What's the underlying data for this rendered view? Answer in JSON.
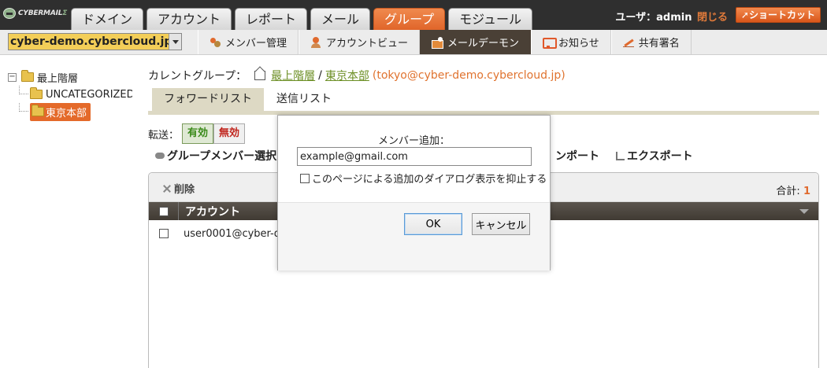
{
  "app": {
    "logo_text": "CYBERMAIL",
    "logo_sig": "Σ"
  },
  "main_tabs": [
    {
      "label": "ドメイン",
      "active": false
    },
    {
      "label": "アカウント",
      "active": false
    },
    {
      "label": "レポート",
      "active": false
    },
    {
      "label": "メール",
      "active": false
    },
    {
      "label": "グループ",
      "active": true
    },
    {
      "label": "モジュール",
      "active": false
    }
  ],
  "user": {
    "prefix": "ユーザ：admin",
    "close_label": "閉じる",
    "shortcut_label": "ショートカット"
  },
  "domain_select": {
    "value": "cyber-demo.cybercloud.jp"
  },
  "sub_tabs": [
    {
      "label": "メンバー管理",
      "icon": "members-icon",
      "active": false
    },
    {
      "label": "アカウントビュー",
      "icon": "account-view-icon",
      "active": false
    },
    {
      "label": "メールデーモン",
      "icon": "mail-daemon-icon",
      "active": true
    },
    {
      "label": "お知らせ",
      "icon": "notice-icon",
      "active": false
    },
    {
      "label": "共有署名",
      "icon": "signature-icon",
      "active": false
    }
  ],
  "tree": {
    "root": {
      "label": "最上階層",
      "toggle": "−"
    },
    "children": [
      {
        "label": "UNCATEGORIZED",
        "selected": false
      },
      {
        "label": "東京本部",
        "selected": true
      }
    ]
  },
  "breadcrumb": {
    "label": "カレントグループ：",
    "root": "最上階層",
    "separator": "/",
    "current_link": "東京本部",
    "current_email": "(tokyo@cyber-demo.cybercloud.jp)"
  },
  "content_tabs": [
    {
      "label": "フォワードリスト",
      "active": true
    },
    {
      "label": "送信リスト",
      "active": false
    }
  ],
  "transfer": {
    "label": "転送：",
    "on_label": "有効",
    "off_label": "無効"
  },
  "tools": {
    "group_select": "グループメンバー選択",
    "import_partial": "ンポート",
    "export": "エクスポート"
  },
  "grid": {
    "delete_label": "削除",
    "total_label": "合計:",
    "total_value": "1",
    "column_account": "アカウント",
    "rows": [
      {
        "account": "user0001@cyber-d"
      }
    ]
  },
  "dialog": {
    "label": "メンバー追加：",
    "input_value": "example@gmail.com",
    "suppress_label": "このページによる追加のダイアログ表示を抑止する",
    "ok_label": "OK",
    "cancel_label": "キャンセル"
  },
  "colors": {
    "accent": "#e46a2a",
    "top_bar": "#2f2f2f",
    "active_subtab": "#4a4036",
    "link_green": "#6b8e23"
  }
}
